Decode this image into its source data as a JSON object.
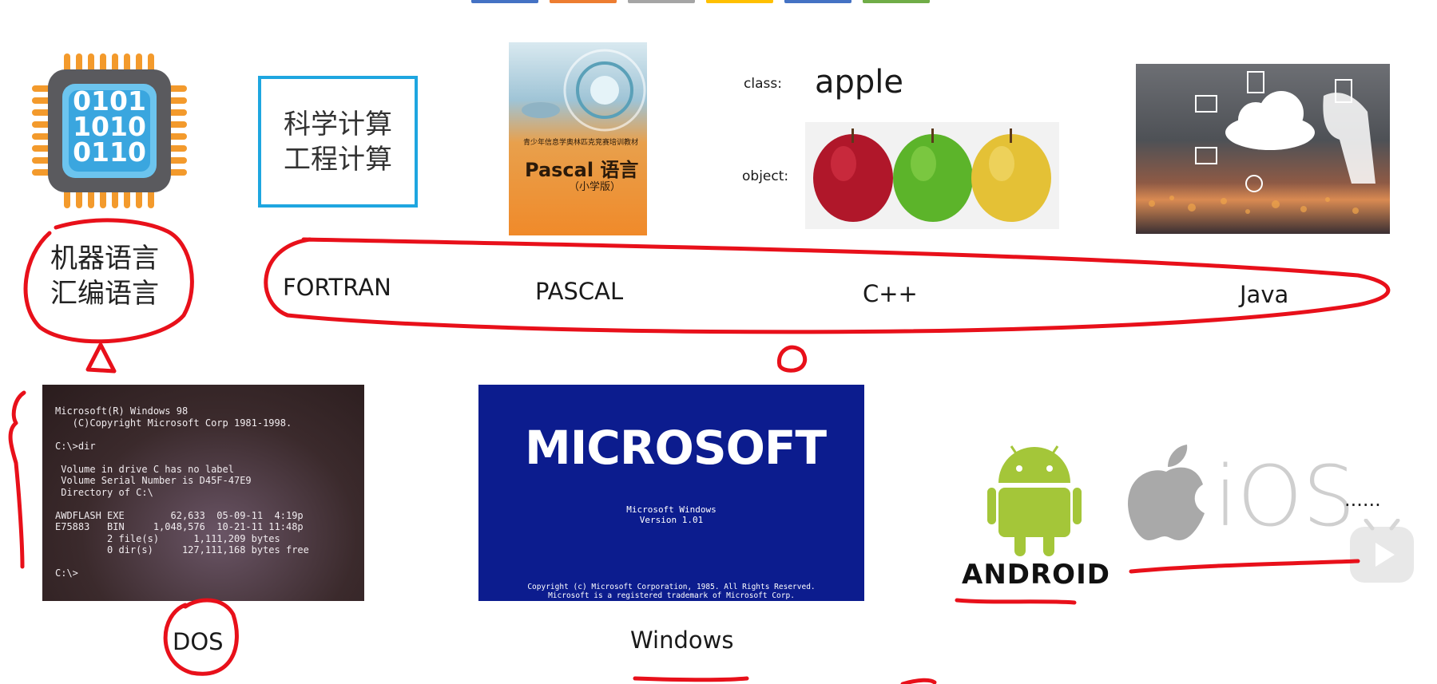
{
  "colors": {
    "annotation_red": "#e8101a",
    "frame_blue": "#1ea6e0",
    "windows_blue": "#0c1c8e",
    "android_green": "#a4c639",
    "chip_orange": "#f39a2c",
    "chip_blue": "#6cc4ee"
  },
  "tab_colors": [
    "#4472c4",
    "#ed7d31",
    "#a5a5a5",
    "#ffc000",
    "#4472c4",
    "#70ad47"
  ],
  "chip": {
    "icon": "binary-chip-icon",
    "lines": [
      "0101",
      "1010",
      "0110"
    ]
  },
  "science": {
    "line1": "科学计算",
    "line2": "工程计算"
  },
  "book": {
    "top_text": "青少年信息学奥林匹克竞赛培训教材",
    "title": "Pascal 语言",
    "sub": "（小学版）"
  },
  "oop": {
    "class_label": "class:",
    "class_value": "apple",
    "object_label": "object:"
  },
  "low_level": {
    "line1": "机器语言",
    "line2": "汇编语言"
  },
  "languages": [
    "FORTRAN",
    "PASCAL",
    "C++",
    "Java"
  ],
  "dos_screen": {
    "lines": [
      "Microsoft(R) Windows 98",
      "   (C)Copyright Microsoft Corp 1981-1998.",
      "",
      "C:\\>dir",
      "",
      " Volume in drive C has no label",
      " Volume Serial Number is D45F-47E9",
      " Directory of C:\\",
      "",
      "AWDFLASH EXE        62,633  05-09-11  4:19p",
      "E75883   BIN     1,048,576  10-21-11 11:48p",
      "         2 file(s)      1,111,209 bytes",
      "         0 dir(s)     127,111,168 bytes free",
      "",
      "C:\\>"
    ]
  },
  "windows_screen": {
    "logo": "MICROSOFT",
    "title1": "Microsoft Windows",
    "title2": "Version 1.01",
    "copy1": "Copyright (c) Microsoft Corporation, 1985.  All Rights Reserved.",
    "copy2": "Microsoft is a registered trademark of Microsoft Corp."
  },
  "os_labels": {
    "dos": "DOS",
    "windows": "Windows"
  },
  "mobile": {
    "android": "ANDROID",
    "ios": "iOS",
    "ellipsis": "......"
  }
}
